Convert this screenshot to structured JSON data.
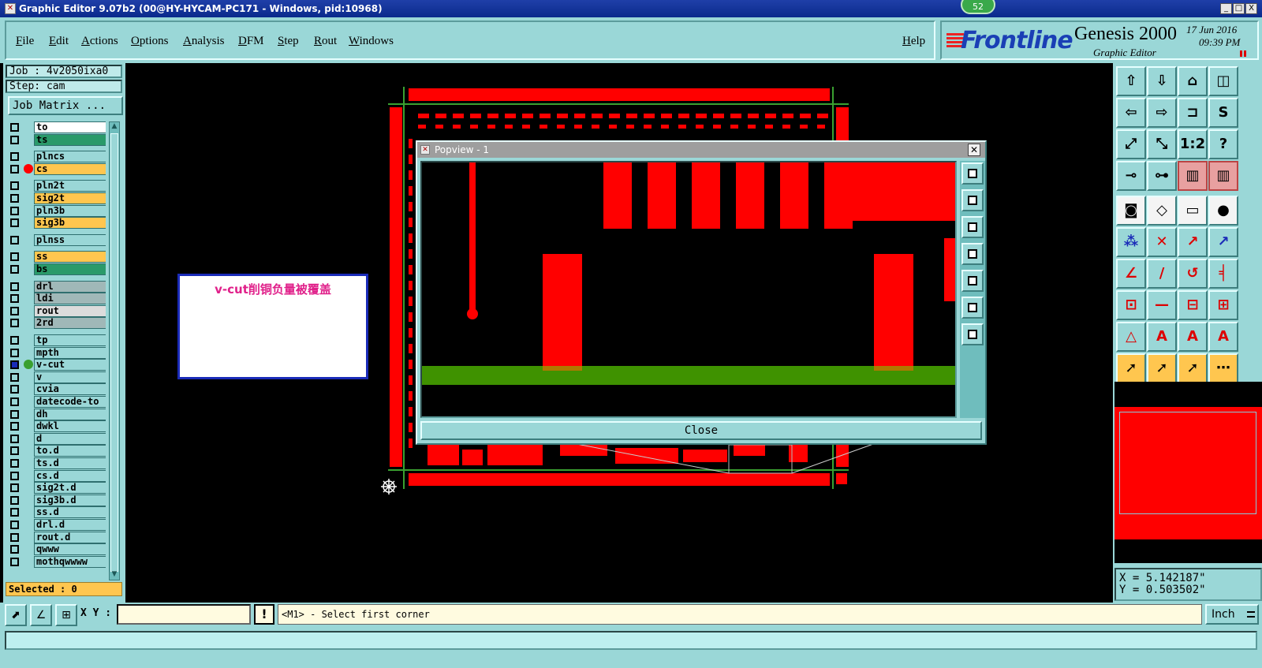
{
  "window": {
    "title": "Graphic Editor 9.07b2 (00@HY-HYCAM-PC171 - Windows, pid:10968)",
    "badge": "52",
    "buttons": [
      "_",
      "□",
      "X"
    ]
  },
  "menu": {
    "items": [
      "File",
      "Edit",
      "Actions",
      "Options",
      "Analysis",
      "DFM",
      "Step",
      "Rout",
      "Windows"
    ],
    "help": "Help"
  },
  "brand": {
    "logo": "Frontline",
    "product": "Genesis 2000",
    "subtitle": "Graphic Editor",
    "date": "17 Jun 2016",
    "time": "09:39 PM"
  },
  "left": {
    "job": "Job : 4v2050ixa0",
    "step": "Step: cam",
    "job_matrix": "Job Matrix ...",
    "layers": [
      {
        "name": "to",
        "color": "#ffffff",
        "dot": ""
      },
      {
        "name": "ts",
        "color": "#2a9a6a",
        "dot": ""
      },
      {
        "name": "plncs",
        "color": "#9ad7d7",
        "dot": ""
      },
      {
        "name": "cs",
        "color": "#ffc64f",
        "dot": "#ff0000"
      },
      {
        "name": "pln2t",
        "color": "#9ad7d7",
        "dot": ""
      },
      {
        "name": "sig2t",
        "color": "#ffc64f",
        "dot": ""
      },
      {
        "name": "pln3b",
        "color": "#9ad7d7",
        "dot": ""
      },
      {
        "name": "sig3b",
        "color": "#ffc64f",
        "dot": ""
      },
      {
        "name": "plnss",
        "color": "#9ad7d7",
        "dot": ""
      },
      {
        "name": "ss",
        "color": "#ffc64f",
        "dot": ""
      },
      {
        "name": "bs",
        "color": "#2a9a6a",
        "dot": ""
      },
      {
        "name": "drl",
        "color": "#a0b8b8",
        "dot": ""
      },
      {
        "name": "ldi",
        "color": "#a0b8b8",
        "dot": ""
      },
      {
        "name": "rout",
        "color": "#dcdcdc",
        "dot": ""
      },
      {
        "name": "2rd",
        "color": "#a0b8b8",
        "dot": ""
      },
      {
        "name": "tp",
        "color": "#9ad7d7",
        "dot": ""
      },
      {
        "name": "mpth",
        "color": "#9ad7d7",
        "dot": ""
      },
      {
        "name": "v-cut",
        "color": "#9ad7d7",
        "dot": "#3aa030",
        "selected": true
      },
      {
        "name": "v",
        "color": "#9ad7d7",
        "dot": ""
      },
      {
        "name": "cvia",
        "color": "#9ad7d7",
        "dot": ""
      },
      {
        "name": "datecode-to",
        "color": "#9ad7d7",
        "dot": ""
      },
      {
        "name": "dh",
        "color": "#9ad7d7",
        "dot": ""
      },
      {
        "name": "dwkl",
        "color": "#9ad7d7",
        "dot": ""
      },
      {
        "name": "d",
        "color": "#9ad7d7",
        "dot": ""
      },
      {
        "name": "to.d",
        "color": "#9ad7d7",
        "dot": ""
      },
      {
        "name": "ts.d",
        "color": "#9ad7d7",
        "dot": ""
      },
      {
        "name": "cs.d",
        "color": "#9ad7d7",
        "dot": ""
      },
      {
        "name": "sig2t.d",
        "color": "#9ad7d7",
        "dot": ""
      },
      {
        "name": "sig3b.d",
        "color": "#9ad7d7",
        "dot": ""
      },
      {
        "name": "ss.d",
        "color": "#9ad7d7",
        "dot": ""
      },
      {
        "name": "drl.d",
        "color": "#9ad7d7",
        "dot": ""
      },
      {
        "name": "rout.d",
        "color": "#9ad7d7",
        "dot": ""
      },
      {
        "name": "qwww",
        "color": "#9ad7d7",
        "dot": ""
      },
      {
        "name": "mothqwwww",
        "color": "#9ad7d7",
        "dot": ""
      }
    ],
    "selected": "Selected : 0"
  },
  "note": {
    "text": "v-cut削铜负量被覆盖"
  },
  "popview": {
    "title": "Popview - 1",
    "close": "Close"
  },
  "coords": {
    "x": "X = 5.142187\"",
    "y": "Y = 0.503502\""
  },
  "bottom": {
    "xy_label": "X Y :",
    "xy_value": "",
    "prompt": "<M1> - Select first corner",
    "units": "Inch",
    "bang": "!"
  }
}
